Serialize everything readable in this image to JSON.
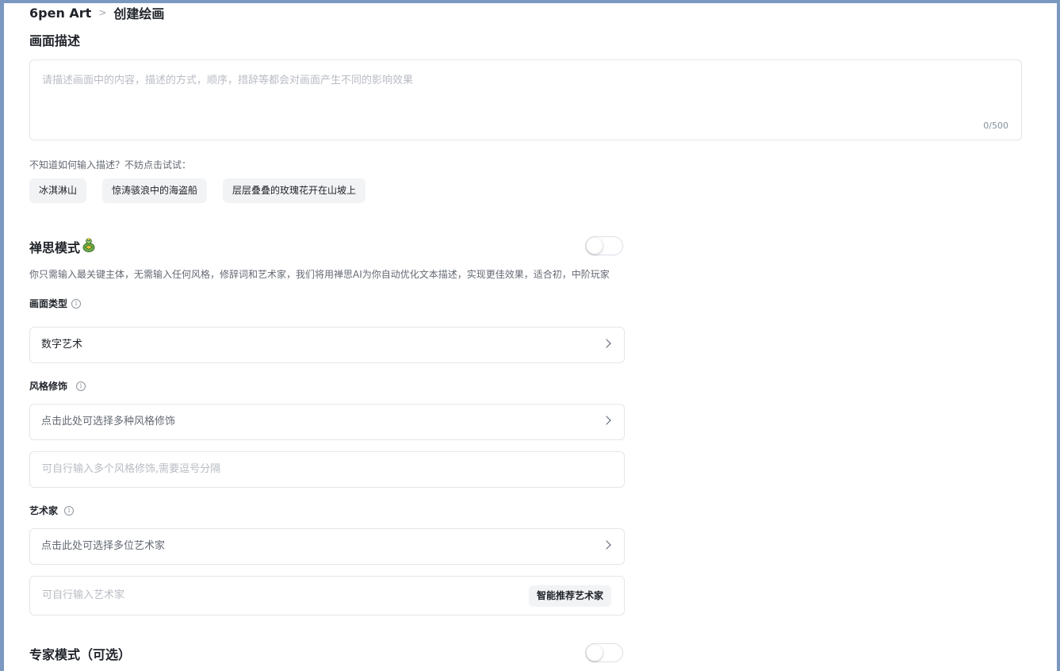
{
  "breadcrumb": {
    "root": "6pen Art",
    "separator": ">",
    "current": "创建绘画"
  },
  "description": {
    "title": "画面描述",
    "placeholder": "请描述画面中的内容，描述的方式，顺序，措辞等都会对画面产生不同的影响效果",
    "value": "",
    "counter": "0/500",
    "hint": "不知道如何输入描述？不妨点击试试：",
    "suggestions": [
      "冰淇淋山",
      "惊涛骇浪中的海盗船",
      "层层叠叠的玫瑰花开在山坡上"
    ]
  },
  "zen_mode": {
    "title": "禅思模式",
    "icon": "tortoise-emoji-icon",
    "enabled": false,
    "subtext": "你只需输入最关键主体，无需输入任何风格，修辞词和艺术家，我们将用禅思AI为你自动优化文本描述，实现更佳效果，适合初，中阶玩家"
  },
  "picture_type": {
    "label": "画面类型",
    "info_icon": "ⓘ",
    "value": "数字艺术"
  },
  "style": {
    "label": "风格修饰",
    "info_icon": "ⓘ",
    "select_placeholder": "点击此处可选择多种风格修饰",
    "input_placeholder": "可自行输入多个风格修饰,需要逗号分隔"
  },
  "artist": {
    "label": "艺术家",
    "info_icon": "ⓘ",
    "select_placeholder": "点击此处可选择多位艺术家",
    "input_placeholder": "可自行输入艺术家",
    "recommend_button": "智能推荐艺术家"
  },
  "expert_mode": {
    "title": "专家模式（可选）",
    "enabled": false
  },
  "colors": {
    "frame": "#7a98c0",
    "text": "#1f2329",
    "muted": "#646a73",
    "placeholder": "#b8bcc3",
    "border": "#e5e6eb",
    "chip_bg": "#f2f3f5"
  }
}
